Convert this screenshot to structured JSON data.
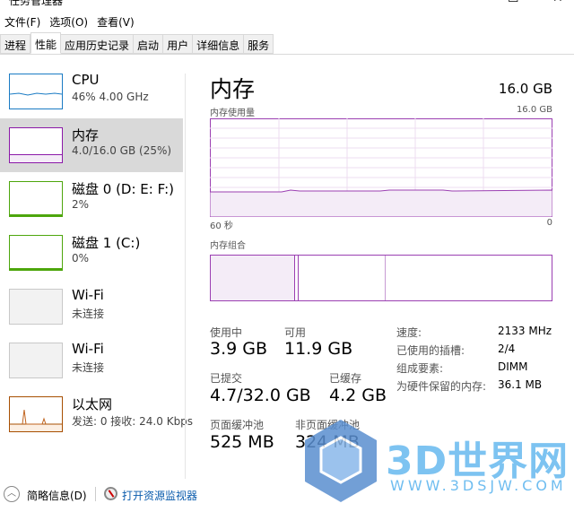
{
  "window": {
    "title": "任务管理器",
    "minimize": "—",
    "maximize": "☐",
    "close": "✕"
  },
  "menu": [
    "文件(F)",
    "选项(O)",
    "查看(V)"
  ],
  "tabs": [
    "进程",
    "性能",
    "应用历史记录",
    "启动",
    "用户",
    "详细信息",
    "服务"
  ],
  "active_tab": "性能",
  "sidebar": [
    {
      "name": "CPU",
      "sub": "46%  4.00 GHz",
      "color": "#1a7bc4"
    },
    {
      "name": "内存",
      "sub": "4.0/16.0 GB (25%)",
      "color": "#8b19a8",
      "selected": true
    },
    {
      "name": "磁盘 0 (D: E: F:)",
      "sub": "2%",
      "color": "#4da60c"
    },
    {
      "name": "磁盘 1 (C:)",
      "sub": "0%",
      "color": "#4da60c"
    },
    {
      "name": "Wi-Fi",
      "sub": "未连接",
      "color": "#c8c8c8"
    },
    {
      "name": "Wi-Fi",
      "sub": "未连接",
      "color": "#c8c8c8"
    },
    {
      "name": "以太网",
      "sub": "发送: 0  接收: 24.0 Kbps",
      "color": "#a74f01"
    }
  ],
  "main": {
    "title": "内存",
    "total": "16.0 GB",
    "usage_label": "内存使用量",
    "usage_max": "16.0 GB",
    "time_left": "60 秒",
    "time_right": "0",
    "usage_percent": 25,
    "composition_label": "内存组合",
    "stats": {
      "in_use_label": "使用中",
      "in_use": "3.9 GB",
      "available_label": "可用",
      "available": "11.9 GB",
      "committed_label": "已提交",
      "committed": "4.7/32.0 GB",
      "cached_label": "已缓存",
      "cached": "4.2 GB",
      "paged_label": "页面缓冲池",
      "paged": "525 MB",
      "nonpaged_label": "非页面缓冲池",
      "nonpaged": "324 MB"
    },
    "details": [
      {
        "k": "速度:",
        "v": "2133 MHz"
      },
      {
        "k": "已使用的插槽:",
        "v": "2/4"
      },
      {
        "k": "组成要素:",
        "v": "DIMM"
      },
      {
        "k": "为硬件保留的内存:",
        "v": "36.1 MB"
      }
    ]
  },
  "footer": {
    "less_details": "简略信息(D)",
    "open_monitor": "打开资源监视器"
  },
  "watermark": {
    "text": "3D世界网",
    "url": "WWW.3DSJW.COM"
  }
}
